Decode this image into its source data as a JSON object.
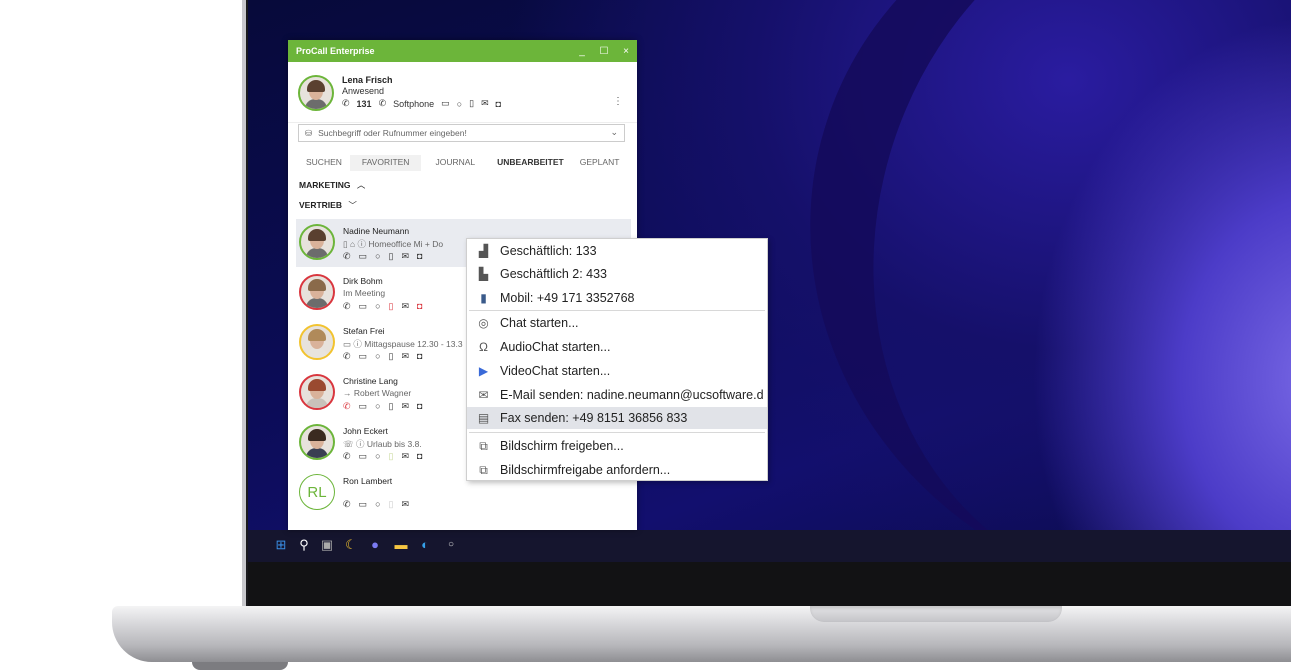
{
  "window": {
    "title": "ProCall Enterprise",
    "minimize": "_",
    "maximize": "☐",
    "close": "×"
  },
  "profile": {
    "name": "Lena Frisch",
    "status": "Anwesend",
    "extension": "131",
    "device": "Softphone",
    "menu": "⋮"
  },
  "search": {
    "placeholder": "Suchbegriff oder Rufnummer eingeben!"
  },
  "tabs": [
    {
      "label": "SUCHEN"
    },
    {
      "label": "FAVORITEN"
    },
    {
      "label": "JOURNAL"
    },
    {
      "label": "UNBEARBEITET"
    },
    {
      "label": "GEPLANT"
    }
  ],
  "groups": [
    {
      "label": "MARKETING",
      "chevron": "^"
    },
    {
      "label": "VERTRIEB",
      "chevron": "v"
    }
  ],
  "contacts": [
    {
      "name": "Nadine Neumann",
      "status": "Homeoffice Mi + Do",
      "color": "#6cb53a"
    },
    {
      "name": "Dirk Bohm",
      "status": "Im Meeting",
      "color": "#d9363e"
    },
    {
      "name": "Stefan Frei",
      "status": "Mittagspause 12.30 - 13.3",
      "color": "#f2c32f"
    },
    {
      "name": "Christine Lang",
      "status": "Robert Wagner",
      "color": "#d9363e"
    },
    {
      "name": "John Eckert",
      "status": "Urlaub bis 3.8.",
      "color": "#6cb53a"
    },
    {
      "name": "Ron Lambert",
      "initials": "RL",
      "status": "",
      "color": "#6cb53a"
    }
  ],
  "context_menu": {
    "items": [
      {
        "label": "Geschäftlich: 133",
        "icon": "office-phone-icon"
      },
      {
        "label": "Geschäftlich 2: 433",
        "icon": "building-icon"
      },
      {
        "label": "Mobil: +49 171 3352768",
        "icon": "mobile-icon"
      },
      {
        "label": "Chat starten...",
        "icon": "chat-icon"
      },
      {
        "label": "AudioChat starten...",
        "icon": "headset-icon"
      },
      {
        "label": "VideoChat starten...",
        "icon": "video-play-icon"
      },
      {
        "label": "E-Mail senden: nadine.neumann@ucsoftware.d",
        "icon": "mail-icon"
      },
      {
        "label": "Fax senden: +49 8151 36856 833",
        "icon": "fax-icon"
      },
      {
        "label": "Bildschirm freigeben...",
        "icon": "screen-share-icon"
      },
      {
        "label": "Bildschirmfreigabe anfordern...",
        "icon": "screen-request-icon"
      }
    ],
    "highlighted": "Fax senden: +49 8151 36856 833"
  },
  "colors": {
    "accent": "#6cb53a",
    "busy": "#d9363e",
    "away": "#f2c32f"
  }
}
